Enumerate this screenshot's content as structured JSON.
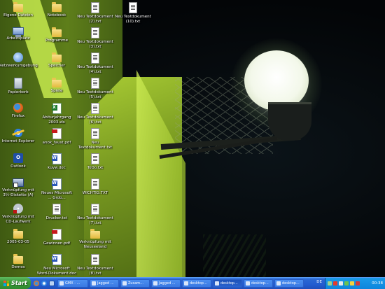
{
  "colors": {
    "taskbar": "#235cd0",
    "start_green": "#3c9b3c",
    "tray": "#0d85dd",
    "icon_label": "#ffffff"
  },
  "desktop": {
    "icons": [
      {
        "label": "Eigene Dateien",
        "icon": "folder-icon"
      },
      {
        "label": "Arbeitsplatz",
        "icon": "computer-icon"
      },
      {
        "label": "Netzwerkumgebung",
        "icon": "network-icon"
      },
      {
        "label": "Papierkorb",
        "icon": "recycle-bin-icon"
      },
      {
        "label": "Firefox",
        "icon": "firefox-icon"
      },
      {
        "label": "Internet Explorer",
        "icon": "internet-explorer-icon"
      },
      {
        "label": "Outlook",
        "icon": "outlook-icon"
      },
      {
        "label": "Verknüpfung mit\n3½-Diskette (A)",
        "icon": "shortcut-icon"
      },
      {
        "label": "Verknüpfung mit\nCD-Laufwerk",
        "icon": "cd-shortcut-icon"
      },
      {
        "label": "2005-03-05",
        "icon": "folder-icon"
      },
      {
        "label": "Demos",
        "icon": "folder-icon"
      },
      {
        "label": "Notebook",
        "icon": "folder-icon"
      },
      {
        "label": "Programme",
        "icon": "folder-icon"
      },
      {
        "label": "Speicher",
        "icon": "folder-icon"
      },
      {
        "label": "Spiele",
        "icon": "folder-icon"
      },
      {
        "label": "Abiturjahrgang\n2003.xls",
        "icon": "excel-icon"
      },
      {
        "label": "anok_faust.pdf",
        "icon": "pdf-icon"
      },
      {
        "label": "kuvw.doc",
        "icon": "word-icon"
      },
      {
        "label": "Neues Microsoft\n... Grob...",
        "icon": "word-icon"
      },
      {
        "label": "Drucker.txt",
        "icon": "text-file-icon"
      },
      {
        "label": "Gewinnen.pdf",
        "icon": "pdf-icon"
      },
      {
        "label": "Neu Microsoft\nWord-Dokument.doc",
        "icon": "word-icon"
      },
      {
        "label": "Neu Textdokument\n(2).txt",
        "icon": "text-file-icon"
      },
      {
        "label": "Neu Textdokument\n(3).txt",
        "icon": "text-file-icon"
      },
      {
        "label": "Neu Textdokument\n(4).txt",
        "icon": "text-file-icon"
      },
      {
        "label": "Neu Textdokument\n(5).txt",
        "icon": "text-file-icon"
      },
      {
        "label": "Neu Textdokument\n(6).txt",
        "icon": "text-file-icon"
      },
      {
        "label": "Neu Textdokument.txt",
        "icon": "text-file-icon"
      },
      {
        "label": "ToDo.txt",
        "icon": "text-file-icon"
      },
      {
        "label": "WICHTIG.TXT",
        "icon": "text-file-icon"
      },
      {
        "label": "Neu Textdokument\n(7).txt",
        "icon": "text-file-icon"
      },
      {
        "label": "Verknüpfung mit\nNeuseeland",
        "icon": "folder-icon"
      },
      {
        "label": "Neu Textdokument\n(8).txt",
        "icon": "text-file-icon"
      },
      {
        "label": "Neu Textdokument\n(10).txt",
        "icon": "text-file-icon"
      }
    ]
  },
  "taskbar": {
    "start_label": "Start",
    "buttons": [
      {
        "label": "GMX - ..."
      },
      {
        "label": "Jagged ..."
      },
      {
        "label": "Zusam..."
      },
      {
        "label": "Jagged ..."
      },
      {
        "label": "desktop..."
      },
      {
        "label": "desktop..."
      },
      {
        "label": "desktop..."
      },
      {
        "label": "desktop..."
      }
    ],
    "language": "DE",
    "clock": "00:38"
  }
}
